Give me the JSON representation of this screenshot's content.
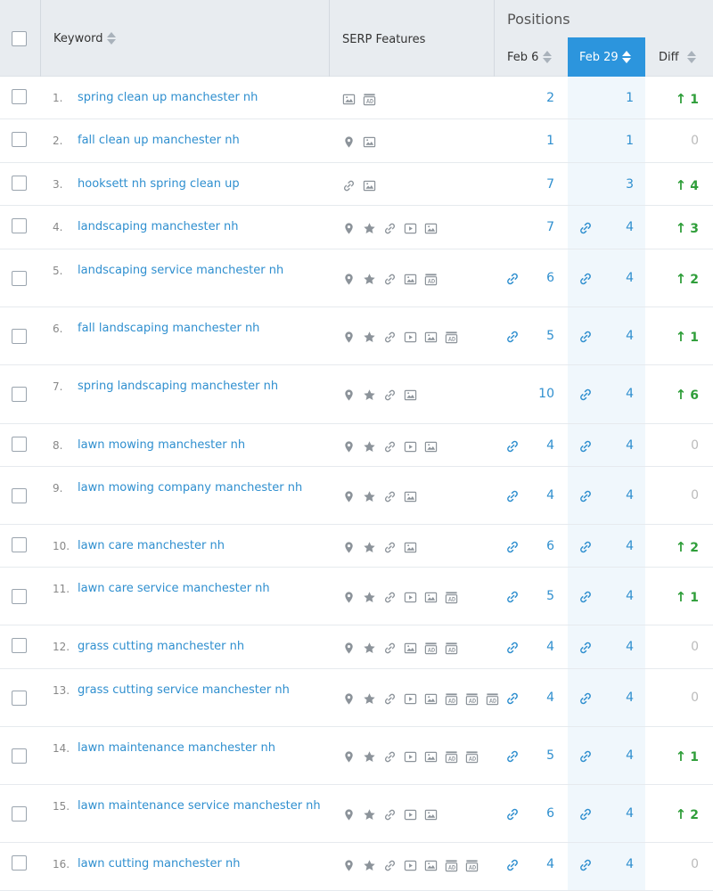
{
  "header": {
    "keyword_label": "Keyword",
    "serp_label": "SERP Features",
    "positions_label": "Positions",
    "feb6_label": "Feb 6",
    "feb29_label": "Feb 29",
    "diff_label": "Diff"
  },
  "colors": {
    "accent": "#2c95dd",
    "link": "#2f8fcf",
    "up": "#2f9e3a",
    "neutral": "#bbbbbb",
    "header_bg": "#e8ecf0"
  },
  "rows": [
    {
      "num": "1.",
      "keyword": "spring clean up manchester nh",
      "features": [
        "image-icon",
        "ad-icon"
      ],
      "feb6_link": false,
      "feb6": "2",
      "feb29_link": false,
      "feb29": "1",
      "diff": "1",
      "diff_dir": "up"
    },
    {
      "num": "2.",
      "keyword": "fall clean up manchester nh",
      "features": [
        "pin-icon",
        "image-icon"
      ],
      "feb6_link": false,
      "feb6": "1",
      "feb29_link": false,
      "feb29": "1",
      "diff": "0",
      "diff_dir": "zero"
    },
    {
      "num": "3.",
      "keyword": "hooksett nh spring clean up",
      "features": [
        "link-icon",
        "image-icon"
      ],
      "feb6_link": false,
      "feb6": "7",
      "feb29_link": false,
      "feb29": "3",
      "diff": "4",
      "diff_dir": "up"
    },
    {
      "num": "4.",
      "keyword": "landscaping manchester nh",
      "features": [
        "pin-icon",
        "star-icon",
        "link-icon",
        "video-icon",
        "image-icon"
      ],
      "feb6_link": false,
      "feb6": "7",
      "feb29_link": true,
      "feb29": "4",
      "diff": "3",
      "diff_dir": "up"
    },
    {
      "num": "5.",
      "keyword": "landscaping service manchester nh",
      "features": [
        "pin-icon",
        "star-icon",
        "link-icon",
        "image-icon",
        "ad-icon"
      ],
      "feb6_link": true,
      "feb6": "6",
      "feb29_link": true,
      "feb29": "4",
      "diff": "2",
      "diff_dir": "up"
    },
    {
      "num": "6.",
      "keyword": "fall landscaping manchester nh",
      "features": [
        "pin-icon",
        "star-icon",
        "link-icon",
        "video-icon",
        "image-icon",
        "ad-icon"
      ],
      "feb6_link": true,
      "feb6": "5",
      "feb29_link": true,
      "feb29": "4",
      "diff": "1",
      "diff_dir": "up"
    },
    {
      "num": "7.",
      "keyword": "spring landscaping manchester nh",
      "features": [
        "pin-icon",
        "star-icon",
        "link-icon",
        "image-icon"
      ],
      "feb6_link": false,
      "feb6": "10",
      "feb29_link": true,
      "feb29": "4",
      "diff": "6",
      "diff_dir": "up"
    },
    {
      "num": "8.",
      "keyword": "lawn mowing manchester nh",
      "features": [
        "pin-icon",
        "star-icon",
        "link-icon",
        "video-icon",
        "image-icon"
      ],
      "feb6_link": true,
      "feb6": "4",
      "feb29_link": true,
      "feb29": "4",
      "diff": "0",
      "diff_dir": "zero"
    },
    {
      "num": "9.",
      "keyword": "lawn mowing company manchester nh",
      "features": [
        "pin-icon",
        "star-icon",
        "link-icon",
        "image-icon"
      ],
      "feb6_link": true,
      "feb6": "4",
      "feb29_link": true,
      "feb29": "4",
      "diff": "0",
      "diff_dir": "zero"
    },
    {
      "num": "10.",
      "keyword": "lawn care manchester nh",
      "features": [
        "pin-icon",
        "star-icon",
        "link-icon",
        "image-icon"
      ],
      "feb6_link": true,
      "feb6": "6",
      "feb29_link": true,
      "feb29": "4",
      "diff": "2",
      "diff_dir": "up"
    },
    {
      "num": "11.",
      "keyword": "lawn care service manchester nh",
      "features": [
        "pin-icon",
        "star-icon",
        "link-icon",
        "video-icon",
        "image-icon",
        "ad-icon"
      ],
      "feb6_link": true,
      "feb6": "5",
      "feb29_link": true,
      "feb29": "4",
      "diff": "1",
      "diff_dir": "up"
    },
    {
      "num": "12.",
      "keyword": "grass cutting manchester nh",
      "features": [
        "pin-icon",
        "star-icon",
        "link-icon",
        "image-icon",
        "ad-icon",
        "ad-icon"
      ],
      "feb6_link": true,
      "feb6": "4",
      "feb29_link": true,
      "feb29": "4",
      "diff": "0",
      "diff_dir": "zero"
    },
    {
      "num": "13.",
      "keyword": "grass cutting service manchester nh",
      "features": [
        "pin-icon",
        "star-icon",
        "link-icon",
        "video-icon",
        "image-icon",
        "ad-icon",
        "ad-icon",
        "ad-icon"
      ],
      "feb6_link": true,
      "feb6": "4",
      "feb29_link": true,
      "feb29": "4",
      "diff": "0",
      "diff_dir": "zero"
    },
    {
      "num": "14.",
      "keyword": "lawn maintenance manchester nh",
      "features": [
        "pin-icon",
        "star-icon",
        "link-icon",
        "video-icon",
        "image-icon",
        "ad-icon",
        "ad-icon"
      ],
      "feb6_link": true,
      "feb6": "5",
      "feb29_link": true,
      "feb29": "4",
      "diff": "1",
      "diff_dir": "up"
    },
    {
      "num": "15.",
      "keyword": "lawn maintenance service manchester nh",
      "features": [
        "pin-icon",
        "star-icon",
        "link-icon",
        "video-icon",
        "image-icon"
      ],
      "feb6_link": true,
      "feb6": "6",
      "feb29_link": true,
      "feb29": "4",
      "diff": "2",
      "diff_dir": "up"
    },
    {
      "num": "16.",
      "keyword": "lawn cutting manchester nh",
      "features": [
        "pin-icon",
        "star-icon",
        "link-icon",
        "video-icon",
        "image-icon",
        "ad-icon",
        "ad-icon"
      ],
      "feb6_link": true,
      "feb6": "4",
      "feb29_link": true,
      "feb29": "4",
      "diff": "0",
      "diff_dir": "zero"
    }
  ]
}
